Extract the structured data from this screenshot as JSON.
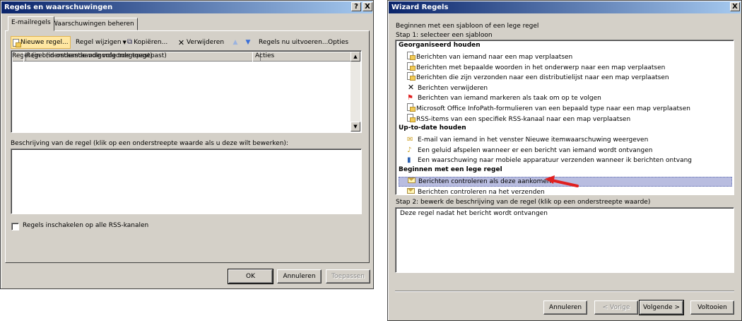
{
  "left_dialog": {
    "title": "Regels en waarschuwingen",
    "help_button": "?",
    "close_button": "X",
    "tabs": [
      {
        "label": "E-mailregels"
      },
      {
        "label": "Waarschuwingen beheren"
      }
    ],
    "toolbar": {
      "new_rule": "Nieuwe regel...",
      "change_rule": "Regel wijzigen",
      "copy": "Kopiëren...",
      "delete": "Verwijderen",
      "run_rules": "Regels nu uitvoeren...",
      "options": "Opties"
    },
    "rules_list": {
      "columns": [
        "Regel (in onderstaande volgorde toegepast)",
        "Acties"
      ]
    },
    "description_label": "Beschrijving van de regel (klik op een onderstreepte waarde als u deze wilt bewerken):",
    "rss_checkbox_label": "Regels inschakelen op alle RSS-kanalen",
    "buttons": {
      "ok": "OK",
      "cancel": "Annuleren",
      "apply": "Toepassen"
    }
  },
  "wizard": {
    "title": "Wizard Regels",
    "close_button": "X",
    "intro": "Beginnen met een sjabloon of een lege regel",
    "step1_label": "Stap 1: selecteer een sjabloon",
    "sections": [
      {
        "header": "Georganiseerd houden",
        "items": [
          {
            "label": "Berichten van iemand naar een map verplaatsen",
            "icon": "move-to-folder-icon"
          },
          {
            "label": "Berichten met bepaalde woorden in het onderwerp naar een map verplaatsen",
            "icon": "move-to-folder-icon"
          },
          {
            "label": "Berichten die zijn verzonden naar een distributielijst naar een map verplaatsen",
            "icon": "move-to-folder-icon"
          },
          {
            "label": "Berichten verwijderen",
            "icon": "delete-icon"
          },
          {
            "label": "Berichten van iemand markeren als taak om op te volgen",
            "icon": "flag-icon"
          },
          {
            "label": "Microsoft Office InfoPath-formulieren van een bepaald type naar een map verplaatsen",
            "icon": "move-to-folder-icon"
          },
          {
            "label": "RSS-items van een specifiek RSS-kanaal naar een map verplaatsen",
            "icon": "move-to-folder-icon"
          }
        ]
      },
      {
        "header": "Up-to-date houden",
        "items": [
          {
            "label": "E-mail van iemand in het venster Nieuwe itemwaarschuwing weergeven",
            "icon": "alert-icon"
          },
          {
            "label": "Een geluid afspelen wanneer er een bericht van iemand wordt ontvangen",
            "icon": "sound-icon"
          },
          {
            "label": "Een waarschuwing naar mobiele apparatuur verzenden wanneer ik berichten ontvang",
            "icon": "mobile-icon"
          }
        ]
      },
      {
        "header": "Beginnen met een lege regel",
        "items": [
          {
            "label": "Berichten controleren als deze aankomen",
            "icon": "envelope-icon",
            "selected": true
          },
          {
            "label": "Berichten controleren na het verzenden",
            "icon": "envelope-icon"
          }
        ]
      }
    ],
    "step2_label": "Stap 2: bewerk de beschrijving van de regel (klik op een onderstreepte waarde)",
    "step2_text": "Deze regel nadat het bericht wordt ontvangen",
    "buttons": {
      "cancel": "Annuleren",
      "back": "< Vorige",
      "next": "Volgende >",
      "finish": "Voltooien"
    }
  },
  "colors": {
    "title_start": "#0a246a",
    "title_end": "#a6caf0",
    "selection": "#b9bde0",
    "annotation_arrow": "#e02020"
  }
}
